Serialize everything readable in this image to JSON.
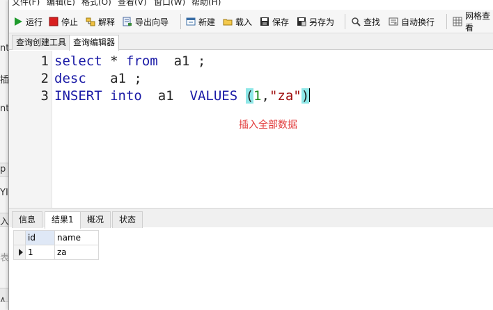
{
  "background_window": {
    "fragments": [
      "nt",
      "插",
      "nt",
      "p",
      "YI",
      "入",
      "表",
      "∧"
    ]
  },
  "menubar": {
    "items": [
      "文件(F)",
      "编辑(E)",
      "格式(O)",
      "查看(V)",
      "窗口(W)",
      "帮助(H)"
    ]
  },
  "toolbar": {
    "run": "运行",
    "stop": "停止",
    "explain": "解释",
    "export_wizard": "导出向导",
    "new": "新建",
    "load": "载入",
    "save": "保存",
    "save_as": "另存为",
    "find": "查找",
    "word_wrap": "自动换行",
    "grid_view": "网格查看"
  },
  "doc_tabs": [
    "查询创建工具",
    "查询编辑器"
  ],
  "editor": {
    "line_numbers": [
      "1",
      "2",
      "3"
    ],
    "lines": [
      [
        {
          "t": "select",
          "c": "kw"
        },
        {
          "t": " * ",
          "c": ""
        },
        {
          "t": "from",
          "c": "kw"
        },
        {
          "t": "  a1 ;",
          "c": ""
        }
      ],
      [
        {
          "t": "desc",
          "c": "kw"
        },
        {
          "t": "   a1 ;",
          "c": ""
        }
      ],
      [
        {
          "t": "INSERT",
          "c": "kw"
        },
        {
          "t": " ",
          "c": ""
        },
        {
          "t": "into",
          "c": "kw"
        },
        {
          "t": "  a1  ",
          "c": ""
        },
        {
          "t": "VALUES",
          "c": "kw"
        },
        {
          "t": " ",
          "c": ""
        },
        {
          "t": "(",
          "c": "paren"
        },
        {
          "t": "1",
          "c": "num"
        },
        {
          "t": ",",
          "c": ""
        },
        {
          "t": "\"za\"",
          "c": "str"
        },
        {
          "t": ")",
          "c": "paren"
        }
      ]
    ],
    "annotation": "插入全部数据"
  },
  "result_tabs": [
    "信息",
    "结果1",
    "概况",
    "状态"
  ],
  "result_grid": {
    "columns": [
      "id",
      "name"
    ],
    "rows": [
      [
        "1",
        "za"
      ]
    ]
  },
  "colors": {
    "keyword": "#1a1aa6",
    "string": "#a01010",
    "number": "#1a8a1a",
    "paren_highlight": "#8ee7e7",
    "annotation": "#e23b3b"
  }
}
